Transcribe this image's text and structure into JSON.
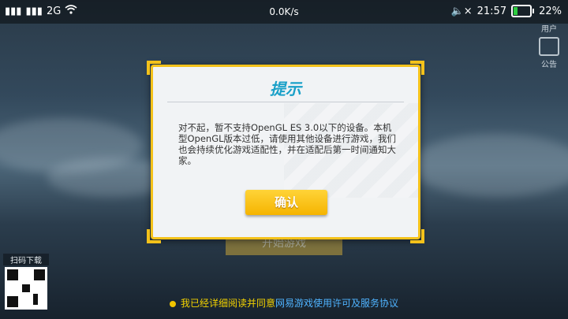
{
  "status_bar": {
    "network": "2G",
    "speed": "0.0K/s",
    "time": "21:57",
    "battery": "22%",
    "battery_level": 0.22
  },
  "side_menu": [
    {
      "label": "用户"
    },
    {
      "label": "公告"
    }
  ],
  "qr": {
    "label": "扫码下载"
  },
  "start_button": {
    "label": "开始游戏"
  },
  "agreement": {
    "prefix": "我已经详细阅读并同意",
    "link": "网易游戏使用许可及服务协议"
  },
  "dialog": {
    "title": "提示",
    "message": "对不起，暂不支持OpenGL ES 3.0以下的设备。本机型OpenGL版本过低，请使用其他设备进行游戏，我们也会持续优化游戏适配性，并在适配后第一时间通知大家。",
    "confirm_label": "确认"
  },
  "colors": {
    "accent": "#f4c21a",
    "title": "#1aa0c8",
    "link": "#4fb3ff"
  }
}
